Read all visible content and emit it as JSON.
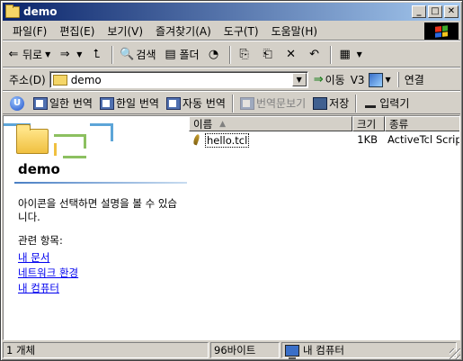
{
  "window": {
    "title": "demo"
  },
  "menu": {
    "items": [
      "파일(F)",
      "편집(E)",
      "보기(V)",
      "즐겨찾기(A)",
      "도구(T)",
      "도움말(H)"
    ]
  },
  "toolbar": {
    "back_label": "뒤로",
    "search_label": "검색",
    "folders_label": "폴더"
  },
  "address": {
    "label": "주소(D)",
    "value": "demo",
    "go_label": "이동",
    "v3_label": "V3",
    "links_label": "연결"
  },
  "translate": {
    "u_label": "U",
    "items": [
      "일한 번역",
      "한일 번역",
      "자동 번역",
      "번역문보기",
      "저장",
      "입력기"
    ]
  },
  "leftpane": {
    "title": "demo",
    "description": "아이콘을 선택하면 설명을 볼 수 있습니다.",
    "related_label": "관련 항목:",
    "links": [
      "내 문서",
      "네트워크 환경",
      "내 컴퓨터"
    ]
  },
  "filelist": {
    "columns": [
      "이름",
      "크기",
      "종류"
    ],
    "rows": [
      {
        "name": "hello.tcl",
        "size": "1KB",
        "type": "ActiveTcl Script"
      }
    ]
  },
  "status": {
    "count": "1 개체",
    "size": "96바이트",
    "location": "내 컴퓨터"
  }
}
